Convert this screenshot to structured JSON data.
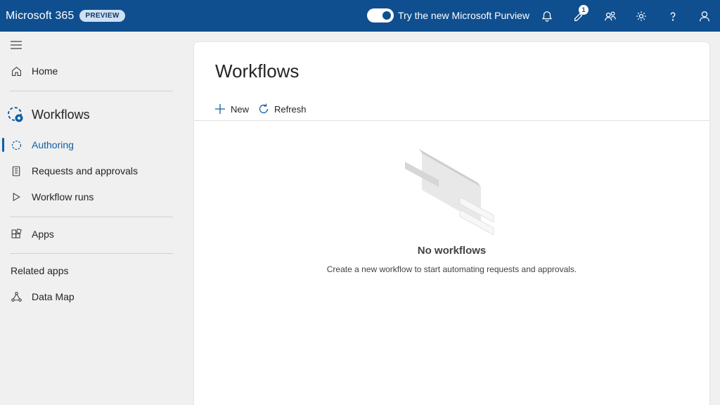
{
  "topbar": {
    "brand": "Microsoft 365",
    "badge": "PREVIEW",
    "toggle_label": "Try the new Microsoft Purview",
    "notification_count": "1"
  },
  "sidebar": {
    "home": "Home",
    "section_title": "Workflows",
    "items": [
      {
        "label": "Authoring"
      },
      {
        "label": "Requests and approvals"
      },
      {
        "label": "Workflow runs"
      }
    ],
    "apps": "Apps",
    "related_heading": "Related apps",
    "data_map": "Data Map"
  },
  "main": {
    "title": "Workflows",
    "new_label": "New",
    "refresh_label": "Refresh",
    "empty_title": "No workflows",
    "empty_desc": "Create a new workflow to start automating requests and approvals."
  },
  "colors": {
    "topbar": "#0f4f8f",
    "accent": "#0f5fa8",
    "sidebar_bg": "#f0f0f0"
  }
}
